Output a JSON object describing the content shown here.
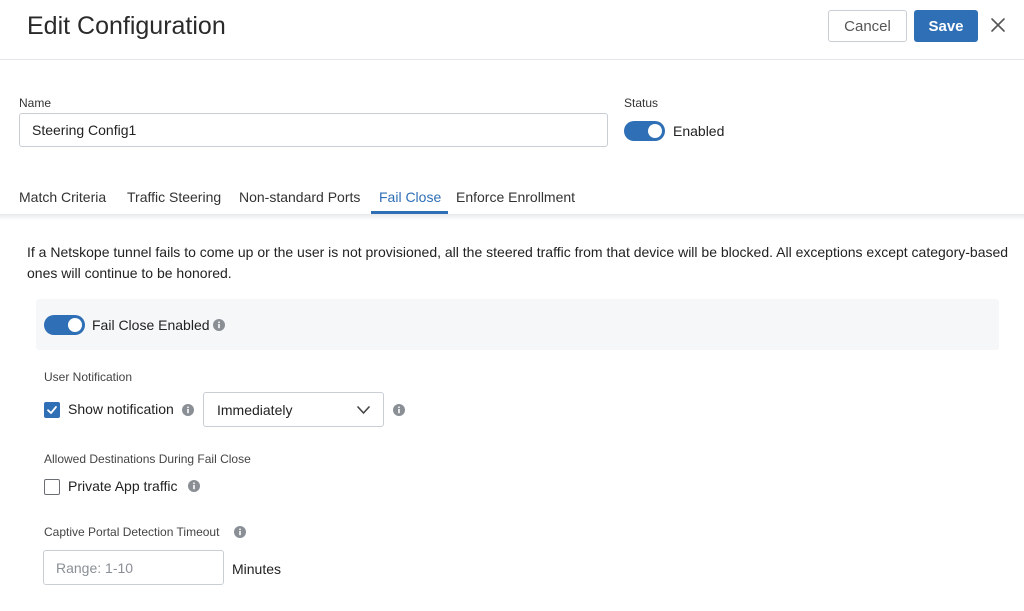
{
  "header": {
    "title": "Edit Configuration",
    "cancel_label": "Cancel",
    "save_label": "Save"
  },
  "form": {
    "name_label": "Name",
    "name_value": "Steering Config1",
    "status_label": "Status",
    "status_value": "Enabled",
    "status_enabled": true
  },
  "tabs": [
    {
      "label": "Match Criteria"
    },
    {
      "label": "Traffic Steering"
    },
    {
      "label": "Non-standard Ports"
    },
    {
      "label": "Fail Close",
      "active": true
    },
    {
      "label": "Enforce Enrollment"
    }
  ],
  "fail_close": {
    "description": "If a Netskope tunnel fails to come up or the user is not provisioned, all the steered traffic from that device will be blocked. All exceptions except category-based ones will continue to be honored.",
    "toggle_label": "Fail Close Enabled",
    "enabled": true,
    "user_notification": {
      "section_label": "User Notification",
      "show_notification_label": "Show notification",
      "show_notification_checked": true,
      "timing_value": "Immediately"
    },
    "allowed_destinations": {
      "section_label": "Allowed Destinations During Fail Close",
      "private_app_label": "Private App traffic",
      "private_app_checked": false
    },
    "captive_portal": {
      "section_label": "Captive Portal Detection Timeout",
      "placeholder": "Range: 1-10",
      "unit": "Minutes"
    }
  },
  "colors": {
    "accent": "#2f6fb6",
    "border": "#c9ced4",
    "panel": "#f6f7f8"
  }
}
